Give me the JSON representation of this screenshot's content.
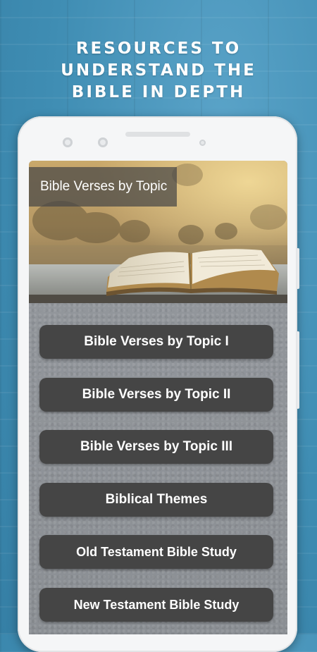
{
  "headline": {
    "line1": "RESOURCES TO UNDERSTAND THE",
    "line2": "BIBLE IN DEPTH"
  },
  "app": {
    "banner_title": "Bible Verses by Topic",
    "menu": [
      {
        "label": "Bible Verses by Topic I"
      },
      {
        "label": "Bible Verses by Topic II"
      },
      {
        "label": "Bible Verses by Topic III"
      },
      {
        "label": "Biblical Themes"
      },
      {
        "label": "Old Testament Bible Study"
      },
      {
        "label": "New Testament Bible Study"
      }
    ]
  },
  "colors": {
    "background": "#3f8db3",
    "button": "#454545",
    "screen": "#8f9398"
  }
}
